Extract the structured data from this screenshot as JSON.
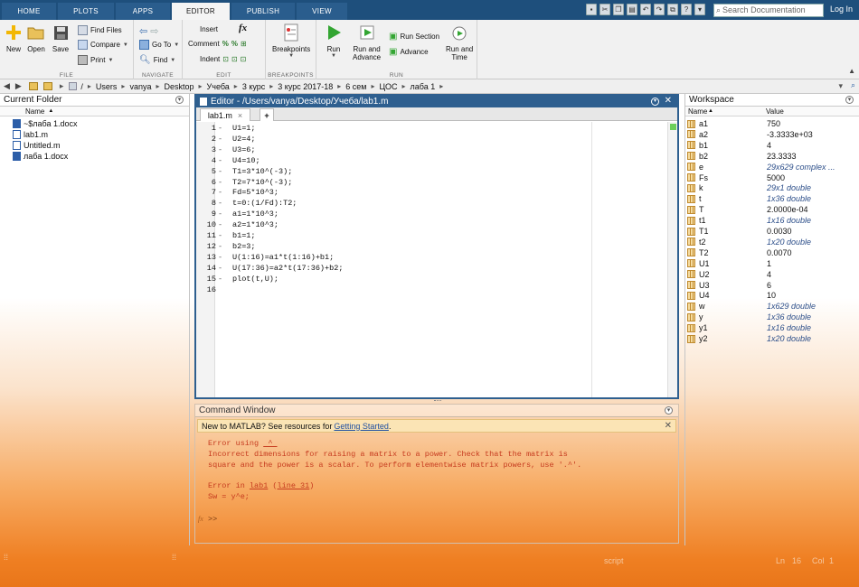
{
  "tabs": [
    "HOME",
    "PLOTS",
    "APPS",
    "EDITOR",
    "PUBLISH",
    "VIEW"
  ],
  "active_tab": "EDITOR",
  "search_placeholder": "Search Documentation",
  "login": "Log In",
  "ribbon": {
    "file": {
      "new": "New",
      "open": "Open",
      "save": "Save",
      "find_files": "Find Files",
      "compare": "Compare",
      "print": "Print",
      "label": "FILE"
    },
    "navigate": {
      "go_to": "Go To",
      "find": "Find",
      "label": "NAVIGATE"
    },
    "edit": {
      "insert": "Insert",
      "fx": "fx",
      "comment": "Comment",
      "indent": "Indent",
      "label": "EDIT"
    },
    "breakpoints": {
      "button": "Breakpoints",
      "label": "BREAKPOINTS"
    },
    "run": {
      "run": "Run",
      "run_and_advance_1": "Run and",
      "run_and_advance_2": "Advance",
      "run_section": "Run Section",
      "advance": "Advance",
      "run_and_time_1": "Run and",
      "run_and_time_2": "Time",
      "label": "RUN"
    }
  },
  "address": [
    "/",
    "Users",
    "vanya",
    "Desktop",
    "Учеба",
    "3 курс",
    "3 курс 2017-18",
    "6 сем",
    "ЦОС",
    "лаба 1"
  ],
  "current_folder": {
    "title": "Current Folder",
    "col_name": "Name",
    "sort_arrow": "▲",
    "files": [
      {
        "name": "~$лаба 1.docx",
        "type": "docx"
      },
      {
        "name": "lab1.m",
        "type": "m"
      },
      {
        "name": "Untitled.m",
        "type": "m"
      },
      {
        "name": "лаба 1.docx",
        "type": "docx"
      }
    ]
  },
  "editor": {
    "title": "Editor - /Users/vanya/Desktop/Учеба/lab1.m",
    "tab": "lab1.m",
    "add_tab": "+",
    "lines": [
      "U1=1;",
      "U2=4;",
      "U3=6;",
      "U4=10;",
      "T1=3*10^(-3);",
      "T2=7*10^(-3);",
      "Fd=5*10^3;",
      "t=0:(1/Fd):T2;",
      "a1=1*10^3;",
      "a2=1*10^3;",
      "b1=1;",
      "b2=3;",
      "U(1:16)=a1*t(1:16)+b1;",
      "U(17:36)=a2*t(17:36)+b2;",
      "plot(t,U);",
      ""
    ]
  },
  "command_window": {
    "title": "Command Window",
    "new_to_matlab": "New to MATLAB? See resources for ",
    "getting_started": "Getting Started",
    "period": ".",
    "err_line1_prefix": "Error using ",
    "err_line1_op": " ^ ",
    "err_line2": "Incorrect dimensions for raising a matrix to a power. Check that the matrix is",
    "err_line3": "square and the power is a scalar. To perform elementwise matrix powers, use '.^'.",
    "err_in_prefix": "Error in ",
    "err_in_fn": "lab1",
    "err_in_line": "line 31",
    "err_code": "Sw = y^e;",
    "prompt_fx": "fx",
    "prompt": ">>"
  },
  "workspace": {
    "title": "Workspace",
    "col_name": "Name",
    "sort_arrow": "▲",
    "col_value": "Value",
    "vars": [
      {
        "name": "a1",
        "value": "750",
        "italic": false
      },
      {
        "name": "a2",
        "value": "-3.3333e+03",
        "italic": false
      },
      {
        "name": "b1",
        "value": "4",
        "italic": false
      },
      {
        "name": "b2",
        "value": "23.3333",
        "italic": false
      },
      {
        "name": "e",
        "value": "29x629 complex ...",
        "italic": true
      },
      {
        "name": "Fs",
        "value": "5000",
        "italic": false
      },
      {
        "name": "k",
        "value": "29x1 double",
        "italic": true
      },
      {
        "name": "t",
        "value": "1x36 double",
        "italic": true
      },
      {
        "name": "T",
        "value": "2.0000e-04",
        "italic": false
      },
      {
        "name": "t1",
        "value": "1x16 double",
        "italic": true
      },
      {
        "name": "T1",
        "value": "0.0030",
        "italic": false
      },
      {
        "name": "t2",
        "value": "1x20 double",
        "italic": true
      },
      {
        "name": "T2",
        "value": "0.0070",
        "italic": false
      },
      {
        "name": "U1",
        "value": "1",
        "italic": false
      },
      {
        "name": "U2",
        "value": "4",
        "italic": false
      },
      {
        "name": "U3",
        "value": "6",
        "italic": false
      },
      {
        "name": "U4",
        "value": "10",
        "italic": false
      },
      {
        "name": "w",
        "value": "1x629 double",
        "italic": true
      },
      {
        "name": "y",
        "value": "1x36 double",
        "italic": true
      },
      {
        "name": "y1",
        "value": "1x16 double",
        "italic": true
      },
      {
        "name": "y2",
        "value": "1x20 double",
        "italic": true
      }
    ]
  },
  "status": {
    "state": "script",
    "ln_label": "Ln",
    "ln": "16",
    "col_label": "Col",
    "col": "1"
  }
}
